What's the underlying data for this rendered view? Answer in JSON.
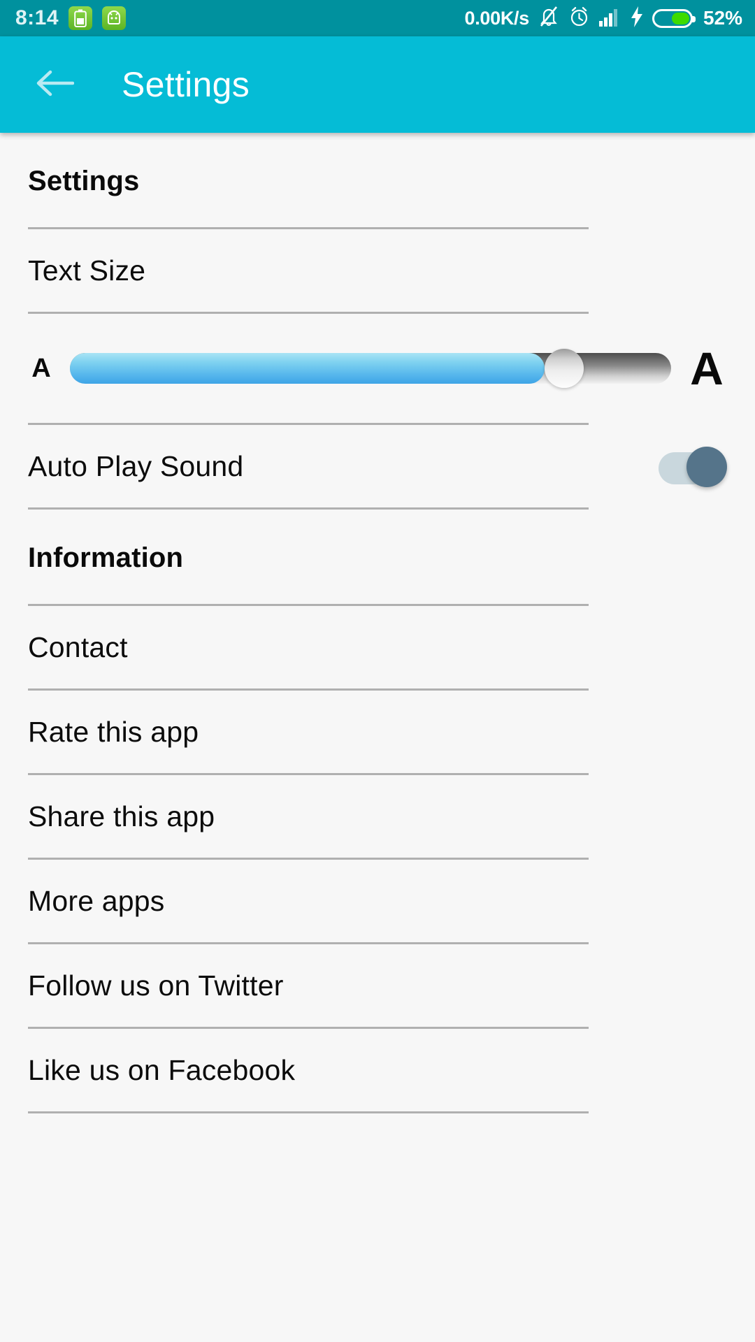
{
  "status_bar": {
    "time": "8:14",
    "network_speed": "0.00K/s",
    "battery_percent": "52%",
    "battery_level": 52,
    "icons": [
      "battery-app-icon",
      "android-robot-app-icon",
      "bell-muted-icon",
      "alarm-clock-icon",
      "signal-bars-icon",
      "charging-bolt-icon",
      "battery-icon"
    ],
    "colors": {
      "background": "#00919e",
      "text": "#ffffff",
      "battery_fill": "#3ddb00"
    }
  },
  "app_bar": {
    "title": "Settings",
    "back_icon": "arrow-left-icon",
    "colors": {
      "background": "#05bcd6",
      "text": "#ffffff"
    }
  },
  "sections": [
    {
      "header": "Settings",
      "rows": [
        {
          "type": "text",
          "label": "Text Size"
        },
        {
          "type": "slider",
          "left_label": "A",
          "right_label": "A",
          "value_percent": 79,
          "track_fill_color": "#55b6ec",
          "thumb_color": "#ededed"
        },
        {
          "type": "toggle",
          "label": "Auto Play Sound",
          "state": "on",
          "thumb_color": "#55748a",
          "track_color": "#c9d7dd"
        }
      ]
    },
    {
      "header": "Information",
      "rows": [
        {
          "type": "text",
          "label": "Contact"
        },
        {
          "type": "text",
          "label": "Rate this app"
        },
        {
          "type": "text",
          "label": "Share this app"
        },
        {
          "type": "text",
          "label": "More apps"
        },
        {
          "type": "text",
          "label": "Follow us on Twitter"
        },
        {
          "type": "text",
          "label": "Like us on Facebook"
        }
      ]
    }
  ]
}
